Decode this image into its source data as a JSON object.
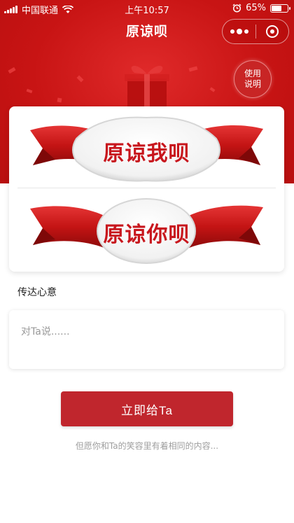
{
  "status_bar": {
    "carrier": "中国联通",
    "time": "上午10:57",
    "battery_percent": "65%",
    "battery_level": 0.65,
    "icons": [
      "signal-icon",
      "wifi-icon",
      "alarm-icon",
      "battery-icon"
    ]
  },
  "nav": {
    "title": "原谅呗",
    "capsule_icons": [
      "more-icon",
      "close-icon"
    ]
  },
  "help_button": {
    "label": "使用说明"
  },
  "options": [
    {
      "label": "原谅我呗"
    },
    {
      "label": "原谅你呗"
    }
  ],
  "message": {
    "section_label": "传达心意",
    "placeholder": "对Ta说......",
    "value": ""
  },
  "submit": {
    "label": "立即给Ta"
  },
  "footer": {
    "note": "但愿你和Ta的笑容里有着相同的内容..."
  },
  "colors": {
    "hero_red": "#c81414",
    "ribbon_red": "#d01a1a",
    "text_red": "#c8161d",
    "button_red": "#c0262d"
  }
}
